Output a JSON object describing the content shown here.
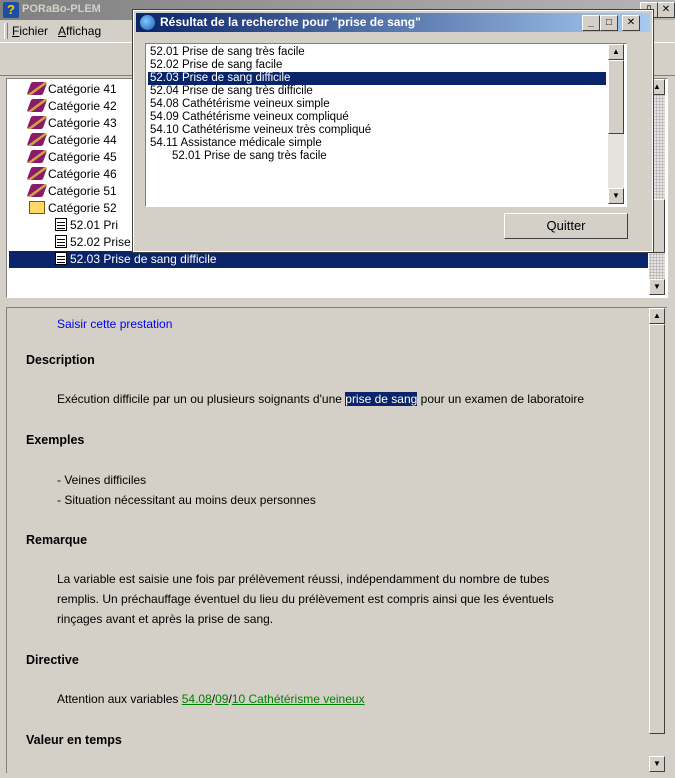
{
  "main_window": {
    "title": "PORaBo-PLEM",
    "menu": {
      "fichier": {
        "accel": "F",
        "rest": "ichier"
      },
      "affichage": {
        "accel": "A",
        "rest": "ffichag"
      }
    }
  },
  "tree": {
    "items": [
      {
        "label": "Catégorie 41",
        "kind": "category"
      },
      {
        "label": "Catégorie 42",
        "kind": "category"
      },
      {
        "label": "Catégorie 43",
        "kind": "category"
      },
      {
        "label": "Catégorie 44",
        "kind": "category"
      },
      {
        "label": "Catégorie 45",
        "kind": "category"
      },
      {
        "label": "Catégorie 46",
        "kind": "category"
      },
      {
        "label": "Catégorie 51",
        "kind": "category"
      },
      {
        "label": "Catégorie 52",
        "kind": "book"
      },
      {
        "label": "52.01 Pri",
        "kind": "doc"
      },
      {
        "label": "52.02 Prise de sang facile",
        "kind": "doc"
      },
      {
        "label": "52.03 Prise de sang difficile",
        "kind": "doc",
        "selected": true
      }
    ]
  },
  "dialog": {
    "title": "Résultat de la recherche pour \"prise de sang\"",
    "results": [
      "52.01 Prise de sang très facile",
      "52.02 Prise de sang facile",
      "52.03 Prise de sang difficile",
      "52.04 Prise de sang très difficile",
      "54.08 Cathétérisme veineux simple",
      "54.09 Cathétérisme veineux compliqué",
      "54.10 Cathétérisme veineux très compliqué",
      "54.11 Assistance médicale simple",
      "52.01 Prise de sang très facile"
    ],
    "selected_index": 2,
    "quit_label": "Quitter"
  },
  "detail": {
    "action_link": "Saisir cette prestation",
    "description_heading": "Description",
    "description_before": "Exécution difficile par un ou plusieurs soignants d'une",
    "description_highlight": "prise de sang",
    "description_after": "pour un examen de laboratoire",
    "examples_heading": "Exemples",
    "examples": [
      "- Veines difficiles",
      "- Situation nécessitant au moins deux personnes"
    ],
    "remark_heading": "Remarque",
    "remark_lines": [
      "La variable est saisie une fois par prélèvement réussi, indépendamment du nombre de tubes",
      "remplis. Un préchauffage éventuel du lieu du prélèvement est compris ainsi que les éventuels",
      "rinçages avant et après la prise de sang."
    ],
    "directive_heading": "Directive",
    "directive_prefix": "Attention aux variables",
    "directive_link1": "54.08",
    "directive_sep1": "/",
    "directive_link2": "09",
    "directive_sep2": "/",
    "directive_link3": "10 Cathétérisme veineux",
    "time_heading": "Valeur en temps"
  }
}
